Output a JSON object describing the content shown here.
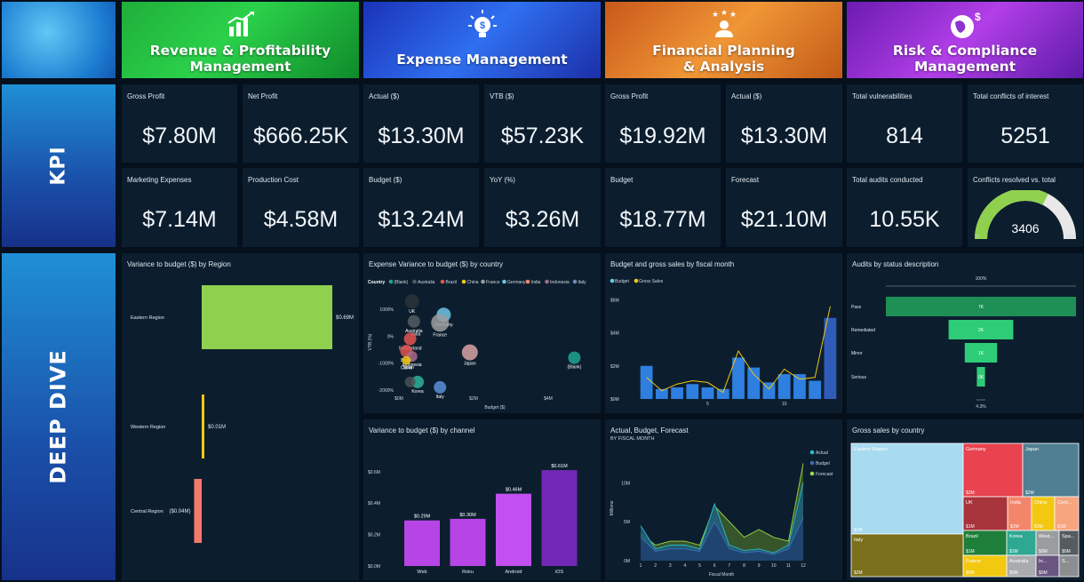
{
  "banners": [
    {
      "title": "Revenue & Profitability\nManagement",
      "icon": "bar-chart-growth-icon"
    },
    {
      "title": "Expense Management",
      "icon": "lightbulb-dollar-icon"
    },
    {
      "title": "Financial Planning\n& Analysis",
      "icon": "person-stars-icon"
    },
    {
      "title": "Risk & Compliance\nManagement",
      "icon": "globe-dollar-icon"
    }
  ],
  "side": {
    "kpi": "KPI",
    "deep_dive": "DEEP DIVE"
  },
  "kpis": [
    {
      "label": "Gross Profit",
      "value": "$7.80M"
    },
    {
      "label": "Net Profit",
      "value": "$666.25K"
    },
    {
      "label": "Actual ($)",
      "value": "$13.30M"
    },
    {
      "label": "VTB ($)",
      "value": "$57.23K"
    },
    {
      "label": "Gross Profit",
      "value": "$19.92M"
    },
    {
      "label": "Actual ($)",
      "value": "$13.30M"
    },
    {
      "label": "Total vulnerabilities",
      "value": "814"
    },
    {
      "label": "Total conflicts of interest",
      "value": "5251"
    },
    {
      "label": "Marketing Expenses",
      "value": "$7.14M"
    },
    {
      "label": "Production Cost",
      "value": "$4.58M"
    },
    {
      "label": "Budget ($)",
      "value": "$13.24M"
    },
    {
      "label": "YoY (%)",
      "value": "$3.26M"
    },
    {
      "label": "Budget",
      "value": "$18.77M"
    },
    {
      "label": "Forecast",
      "value": "$21.10M"
    },
    {
      "label": "Total audits conducted",
      "value": "10.55K"
    }
  ],
  "gauge": {
    "label": "Conflicts resolved vs. total",
    "value": "3406",
    "min": "0",
    "max": "5251",
    "fraction": 0.649
  },
  "panels": {
    "region": "Variance to budget ($) by Region",
    "scatter": "Expense Variance to budget ($) by country",
    "fiscal": "Budget and gross sales by fiscal month",
    "audits": "Audits by status description",
    "channel": "Variance to budget ($) by channel",
    "abf": "Actual, Budget, Forecast",
    "abf_sub": "BY FISCAL MONTH",
    "treemap": "Gross sales by country"
  },
  "chart_data": [
    {
      "type": "bar",
      "title": "Variance to budget ($) by Region",
      "categories": [
        "Eastern Region",
        "Western Region",
        "Central Region"
      ],
      "values": [
        0.69,
        0.01,
        -0.04
      ],
      "labels": [
        "$0.69M",
        "$0.01M",
        "($0.04M)"
      ],
      "colors": [
        "#8fd14f",
        "#f2c811",
        "#f47a6c"
      ]
    },
    {
      "type": "scatter",
      "title": "Expense Variance to budget ($) by country",
      "legend_title": "Country",
      "legend": [
        {
          "name": "(Blank)",
          "color": "#1fa58f"
        },
        {
          "name": "Australia",
          "color": "#555b60"
        },
        {
          "name": "Brazil",
          "color": "#e4534f"
        },
        {
          "name": "China",
          "color": "#f2c811"
        },
        {
          "name": "France",
          "color": "#9a9da0"
        },
        {
          "name": "Germany",
          "color": "#6ec6e6"
        },
        {
          "name": "India",
          "color": "#f3866a"
        },
        {
          "name": "Indonesia",
          "color": "#a86b8c"
        },
        {
          "name": "Italy",
          "color": "#6e89b8"
        }
      ],
      "xlabel": "Budget ($)",
      "ylabel": "VTB (%)",
      "xticks": [
        "$0M",
        "$2M",
        "$4M"
      ],
      "yticks": [
        "1000%",
        "0%",
        "-1000%",
        "-2000%"
      ],
      "xlim": [
        0,
        5
      ],
      "ylim": [
        -2200,
        1500
      ],
      "points": [
        {
          "name": "UK",
          "x": 0.35,
          "y": 1300,
          "r": 8,
          "color": "#2c3338"
        },
        {
          "name": "Australia",
          "x": 0.4,
          "y": 550,
          "r": 7,
          "color": "#555b60"
        },
        {
          "name": "Germany",
          "x": 1.2,
          "y": 800,
          "r": 8,
          "color": "#6ec6e6"
        },
        {
          "name": "France",
          "x": 1.1,
          "y": 500,
          "r": 10,
          "color": "#9a9da0"
        },
        {
          "name": "India",
          "x": 0.45,
          "y": 200,
          "r": 0,
          "color": "#f3866a"
        },
        {
          "name": "Switzerland",
          "x": 0.3,
          "y": -100,
          "r": 7,
          "color": "#e4534f"
        },
        {
          "name": "Brazil",
          "x": 0.2,
          "y": -550,
          "r": 7,
          "color": "#e4534f"
        },
        {
          "name": "Indonesia",
          "x": 0.35,
          "y": -750,
          "r": 6,
          "color": "#a86b8c"
        },
        {
          "name": "China",
          "x": 0.2,
          "y": -900,
          "r": 5,
          "color": "#f2c811"
        },
        {
          "name": "Spain",
          "x": 0.25,
          "y": -1050,
          "r": 0,
          "color": "#f3866a"
        },
        {
          "name": "Japan",
          "x": 1.9,
          "y": -600,
          "r": 9,
          "color": "#d8a3a3"
        },
        {
          "name": "(Blank)",
          "x": 4.7,
          "y": -800,
          "r": 7,
          "color": "#1fa58f"
        },
        {
          "name": "Korea",
          "x": 0.5,
          "y": -1700,
          "r": 7,
          "color": "#2fb39a"
        },
        {
          "name": "Italy",
          "x": 1.1,
          "y": -1900,
          "r": 7,
          "color": "#5a8fd8"
        },
        {
          "name": "",
          "x": 0.3,
          "y": -1700,
          "r": 6,
          "color": "#4a4f55"
        }
      ]
    },
    {
      "type": "bar",
      "title": "Budget and gross sales by fiscal month",
      "legend": [
        {
          "name": "Budget",
          "color": "#6ec6e6"
        },
        {
          "name": "Gross Sales",
          "color": "#f2c811"
        }
      ],
      "categories": [
        1,
        2,
        3,
        4,
        5,
        6,
        7,
        8,
        9,
        10,
        11,
        12,
        13
      ],
      "xticks": [
        "5",
        "10"
      ],
      "yticks": [
        "$0M",
        "$2M",
        "$4M",
        "$6M"
      ],
      "ylim": [
        0,
        6.5
      ],
      "values": [
        2.0,
        0.6,
        0.7,
        0.9,
        0.7,
        0.6,
        2.5,
        1.9,
        1.0,
        1.5,
        1.5,
        1.1,
        4.9
      ],
      "line": [
        1.3,
        0.5,
        0.9,
        1.1,
        1.0,
        0.4,
        2.9,
        1.5,
        0.6,
        1.8,
        1.2,
        1.3,
        5.6
      ]
    },
    {
      "type": "funnel",
      "title": "Audits by status description",
      "top_label": "100%",
      "bottom_label": "4.3%",
      "stages": [
        {
          "name": "Pass",
          "value_label": "7K",
          "fraction": 1.0
        },
        {
          "name": "Remediated",
          "value_label": "2K",
          "fraction": 0.34
        },
        {
          "name": "Minor",
          "value_label": "1K",
          "fraction": 0.17
        },
        {
          "name": "Serious",
          "value_label": "0K",
          "fraction": 0.043
        }
      ]
    },
    {
      "type": "bar",
      "title": "Variance to budget ($) by channel",
      "categories": [
        "Web",
        "Roku",
        "Android",
        "iOS"
      ],
      "values": [
        0.29,
        0.3,
        0.46,
        0.61
      ],
      "labels": [
        "$0.29M",
        "$0.30M",
        "$0.46M",
        "$0.61M"
      ],
      "yticks": [
        "$0.0M",
        "$0.2M",
        "$0.4M",
        "$0.6M"
      ],
      "ylim": [
        0,
        0.65
      ],
      "colors": [
        "#b745e6",
        "#b745e6",
        "#c24ff0",
        "#7228b4"
      ]
    },
    {
      "type": "area",
      "title": "Actual, Budget, Forecast",
      "xlabel": "Fiscal Month",
      "ylabel": "Millions",
      "x": [
        1,
        2,
        3,
        4,
        5,
        6,
        7,
        8,
        9,
        10,
        11,
        12
      ],
      "yticks": [
        "0M",
        "5M",
        "10M"
      ],
      "ylim": [
        0,
        13
      ],
      "series": [
        {
          "name": "Actual",
          "color": "#2fb8c8",
          "values": [
            4.5,
            1.5,
            2.0,
            2.0,
            1.5,
            7.3,
            2.0,
            1.3,
            1.5,
            1.0,
            2.0,
            10.0
          ]
        },
        {
          "name": "Budget",
          "color": "#3a6fb8",
          "values": [
            3.0,
            1.2,
            1.5,
            1.5,
            1.2,
            5.0,
            1.5,
            1.0,
            1.2,
            0.8,
            1.5,
            5.5
          ]
        },
        {
          "name": "Forecast",
          "color": "#9bd84a",
          "values": [
            3.5,
            2.0,
            2.5,
            2.5,
            2.0,
            7.0,
            5.0,
            3.0,
            4.0,
            3.0,
            2.5,
            12.5
          ]
        }
      ]
    },
    {
      "type": "treemap",
      "title": "Gross sales by country",
      "items": [
        {
          "name": "Eastern Region",
          "value_label": "$7M",
          "color": "#a8daf0"
        },
        {
          "name": "Germany",
          "value_label": "$2M",
          "color": "#e8434f"
        },
        {
          "name": "Japan",
          "value_label": "$2M",
          "color": "#4f7f92"
        },
        {
          "name": "UK",
          "value_label": "$1M",
          "color": "#a8343b"
        },
        {
          "name": "India",
          "value_label": "$1M",
          "color": "#f3866a"
        },
        {
          "name": "China",
          "value_label": "$1M",
          "color": "#f2c811"
        },
        {
          "name": "Cent...",
          "value_label": "$1M",
          "color": "#f6a57e"
        },
        {
          "name": "Brazil",
          "value_label": "$1M",
          "color": "#1e7f3a"
        },
        {
          "name": "Korea",
          "value_label": "$1M",
          "color": "#2ea892"
        },
        {
          "name": "West...",
          "value_label": "$0M",
          "color": "#9a9da0"
        },
        {
          "name": "Spa...",
          "value_label": "$0M",
          "color": "#555b60"
        },
        {
          "name": "Italy",
          "value_label": "$2M",
          "color": "#7a6f1a"
        },
        {
          "name": "France",
          "value_label": "$0M",
          "color": "#f2c811"
        },
        {
          "name": "Australia",
          "value_label": "$0M",
          "color": "#a9abae"
        },
        {
          "name": "In...",
          "value_label": "$0M",
          "color": "#6a5580"
        },
        {
          "name": "S...",
          "value_label": "",
          "color": "#8c8f92"
        }
      ]
    }
  ]
}
